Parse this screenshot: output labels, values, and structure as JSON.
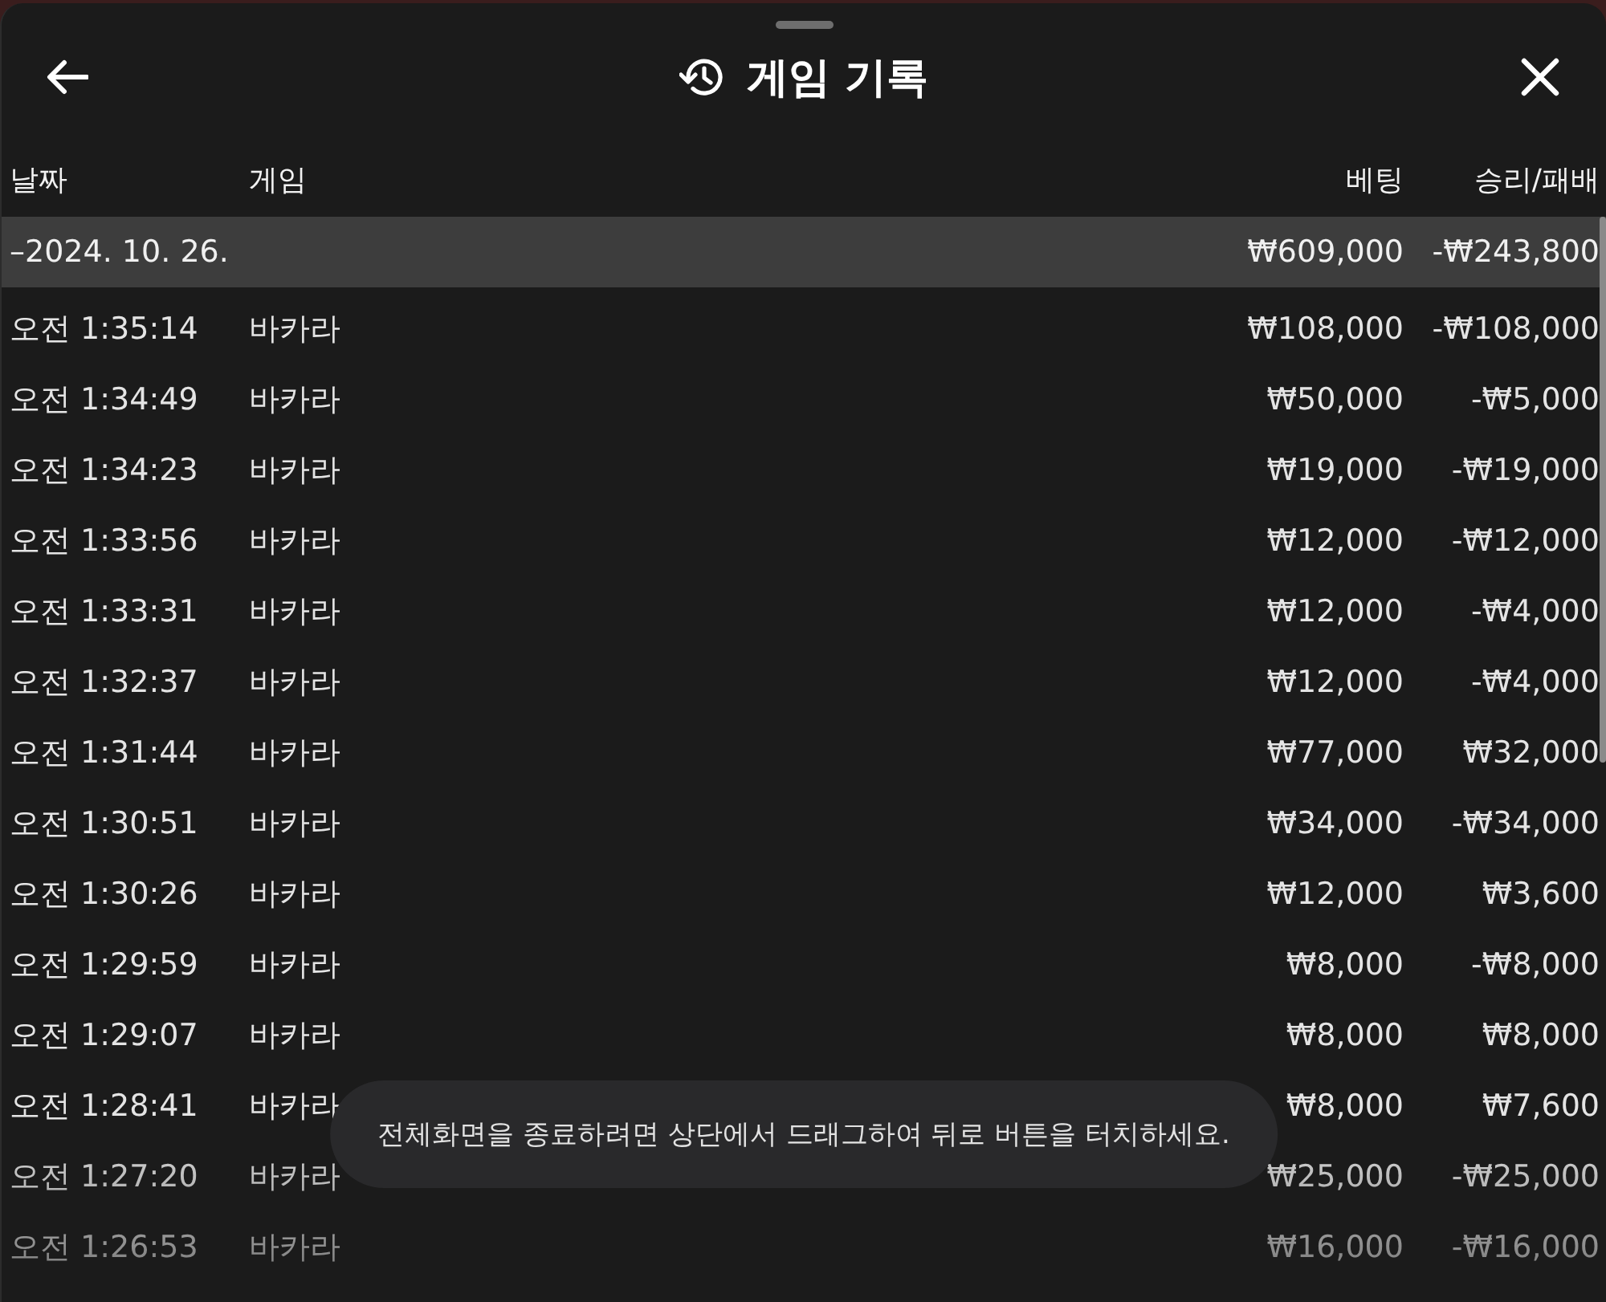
{
  "header": {
    "title": "게임 기록"
  },
  "table": {
    "columns": [
      "날짜",
      "게임",
      "베팅",
      "승리/패배"
    ],
    "groups": [
      {
        "date": "–2024. 10. 26.",
        "bet": "₩609,000",
        "result": "-₩243,800",
        "rows": [
          {
            "time": "오전 1:35:14",
            "game": "바카라",
            "bet": "₩108,000",
            "result": "-₩108,000"
          },
          {
            "time": "오전 1:34:49",
            "game": "바카라",
            "bet": "₩50,000",
            "result": "-₩5,000"
          },
          {
            "time": "오전 1:34:23",
            "game": "바카라",
            "bet": "₩19,000",
            "result": "-₩19,000"
          },
          {
            "time": "오전 1:33:56",
            "game": "바카라",
            "bet": "₩12,000",
            "result": "-₩12,000"
          },
          {
            "time": "오전 1:33:31",
            "game": "바카라",
            "bet": "₩12,000",
            "result": "-₩4,000"
          },
          {
            "time": "오전 1:32:37",
            "game": "바카라",
            "bet": "₩12,000",
            "result": "-₩4,000"
          },
          {
            "time": "오전 1:31:44",
            "game": "바카라",
            "bet": "₩77,000",
            "result": "₩32,000"
          },
          {
            "time": "오전 1:30:51",
            "game": "바카라",
            "bet": "₩34,000",
            "result": "-₩34,000"
          },
          {
            "time": "오전 1:30:26",
            "game": "바카라",
            "bet": "₩12,000",
            "result": "₩3,600"
          },
          {
            "time": "오전 1:29:59",
            "game": "바카라",
            "bet": "₩8,000",
            "result": "-₩8,000"
          },
          {
            "time": "오전 1:29:07",
            "game": "바카라",
            "bet": "₩8,000",
            "result": "₩8,000"
          },
          {
            "time": "오전 1:28:41",
            "game": "바카라",
            "bet": "₩8,000",
            "result": "₩7,600"
          },
          {
            "time": "오전 1:27:20",
            "game": "바카라",
            "bet": "₩25,000",
            "result": "-₩25,000"
          },
          {
            "time": "오전 1:26:53",
            "game": "바카라",
            "bet": "₩16,000",
            "result": "-₩16,000"
          }
        ]
      }
    ]
  },
  "toast": {
    "text": "전체화면을 종료하려면 상단에서 드래그하여 뒤로 버튼을 터치하세요."
  }
}
